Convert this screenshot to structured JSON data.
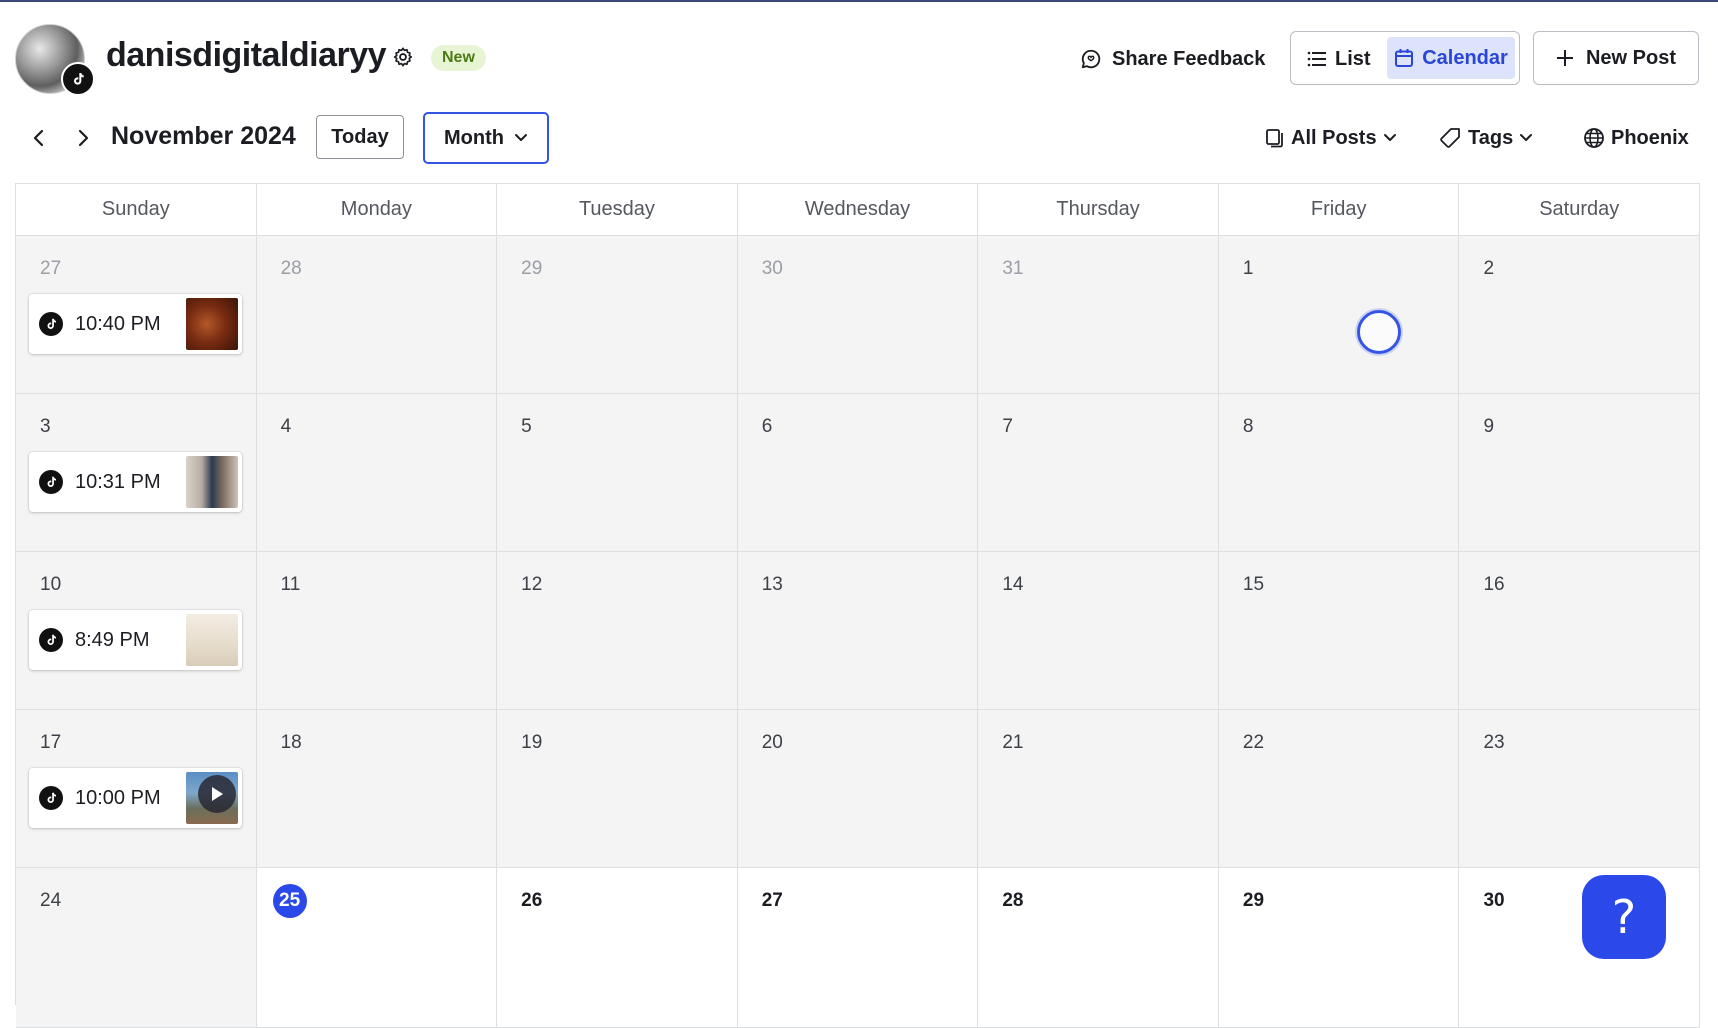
{
  "header": {
    "account_name": "danisdigitaldiaryy",
    "new_badge": "New",
    "share_feedback": "Share Feedback",
    "view_list": "List",
    "view_calendar": "Calendar",
    "new_post": "New Post"
  },
  "toolbar": {
    "month_label": "November 2024",
    "today": "Today",
    "view_mode": "Month",
    "all_posts": "All Posts",
    "tags": "Tags",
    "timezone": "Phoenix"
  },
  "weekdays": [
    "Sunday",
    "Monday",
    "Tuesday",
    "Wednesday",
    "Thursday",
    "Friday",
    "Saturday"
  ],
  "weeks": [
    [
      "27",
      "28",
      "29",
      "30",
      "31",
      "1",
      "2"
    ],
    [
      "3",
      "4",
      "5",
      "6",
      "7",
      "8",
      "9"
    ],
    [
      "10",
      "11",
      "12",
      "13",
      "14",
      "15",
      "16"
    ],
    [
      "17",
      "18",
      "19",
      "20",
      "21",
      "22",
      "23"
    ],
    [
      "24",
      "25",
      "26",
      "27",
      "28",
      "29",
      "30"
    ]
  ],
  "posts": [
    "10:40 PM",
    "10:31 PM",
    "8:49 PM",
    "10:00 PM"
  ],
  "help": "?",
  "colors": {
    "accent": "#2b48e8",
    "accent_light": "#dde3fa",
    "new_badge_bg": "#e8f5d4",
    "past_day_bg": "#f4f4f5"
  }
}
